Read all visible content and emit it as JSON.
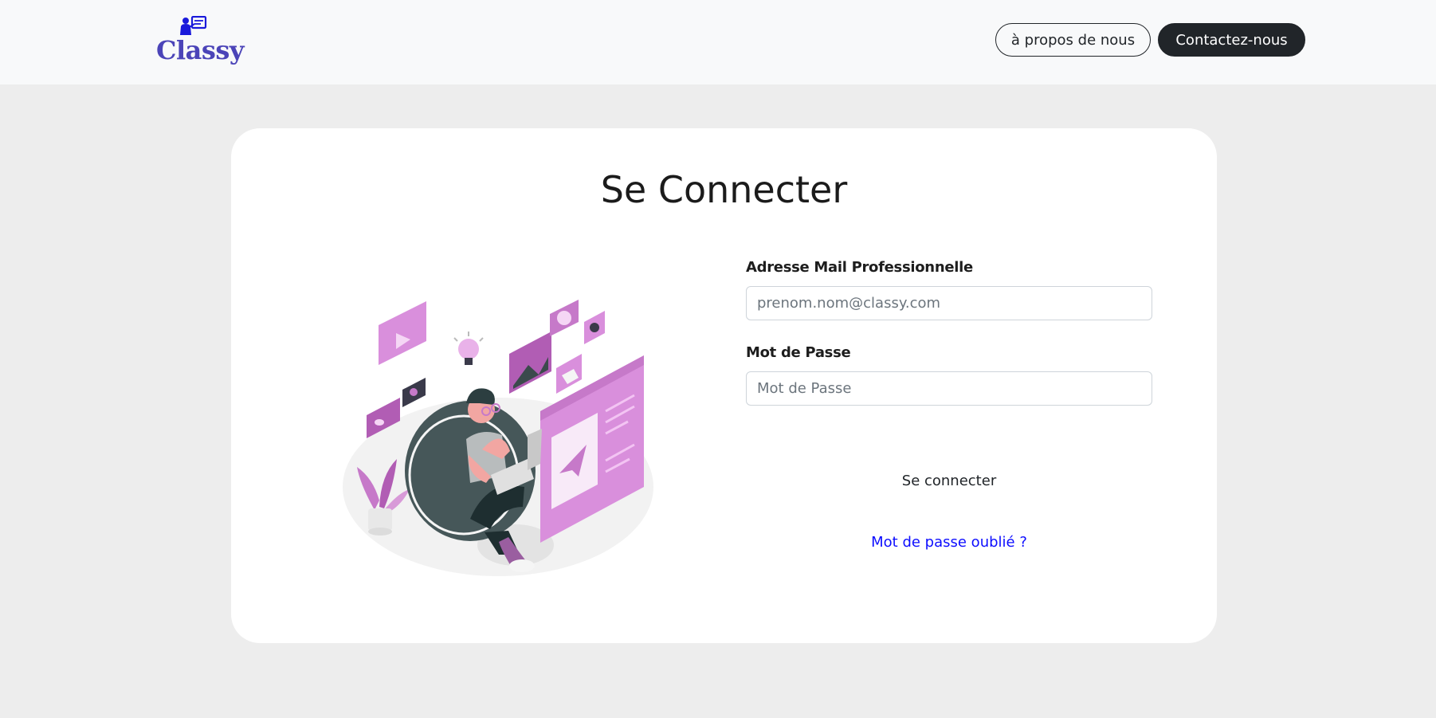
{
  "brand": {
    "name": "Classy",
    "icon": "teacher-board-icon",
    "color": "#4b44b8"
  },
  "nav": {
    "about_label": "à propos de nous",
    "contact_label": "Contactez-nous"
  },
  "login": {
    "title": "Se Connecter",
    "illustration": "person-with-laptop-illustration",
    "email": {
      "label": "Adresse Mail Professionnelle",
      "placeholder": "prenom.nom@classy.com",
      "value": ""
    },
    "password": {
      "label": "Mot de Passe",
      "placeholder": "Mot de Passe",
      "value": ""
    },
    "submit_label": "Se connecter",
    "forgot_label": "Mot de passe oublié ?"
  },
  "colors": {
    "accent": "#c679c9",
    "dark": "#212529",
    "link": "#0d0dff",
    "background": "#ededed"
  }
}
